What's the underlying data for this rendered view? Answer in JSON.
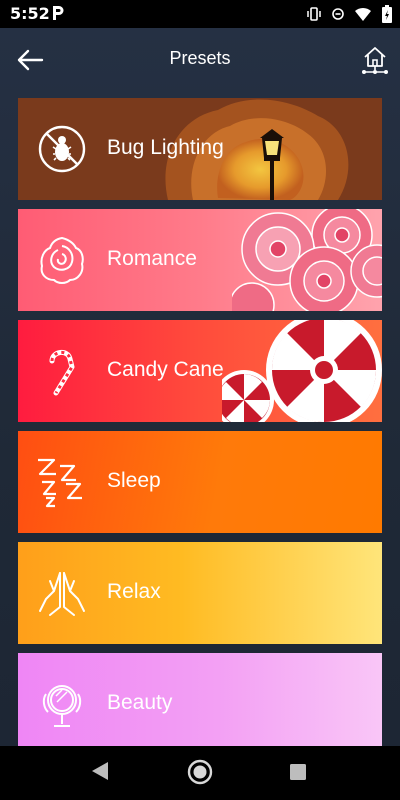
{
  "status_bar": {
    "time": "5:52",
    "icons": [
      "parking-app-icon",
      "vibrate-icon",
      "minus-icon",
      "wifi-icon",
      "battery-charging-icon"
    ]
  },
  "header": {
    "title": "Presets",
    "back_icon": "arrow-left-icon",
    "home_icon": "home-network-icon"
  },
  "presets": [
    {
      "label": "Bug Lighting",
      "icon": "no-bug-icon",
      "art": "street-lamp-glow"
    },
    {
      "label": "Romance",
      "icon": "rose-icon",
      "art": "pink-roses"
    },
    {
      "label": "Candy Cane",
      "icon": "candy-cane-icon",
      "art": "peppermint-candies"
    },
    {
      "label": "Sleep",
      "icon": "zzz-icon",
      "art": ""
    },
    {
      "label": "Relax",
      "icon": "praying-hands-icon",
      "art": ""
    },
    {
      "label": "Beauty",
      "icon": "vanity-mirror-icon",
      "art": ""
    }
  ],
  "nav_bar": {
    "back": "nav-back-triangle-icon",
    "home": "nav-home-circle-icon",
    "recents": "nav-recents-square-icon"
  },
  "colors": {
    "background": "#222c3c",
    "bug_lighting": "#7a3a1c",
    "romance": "#ff6b80",
    "candy_cane": "#ff2a40",
    "sleep": "#ff6a0c",
    "relax": "#ffb81f",
    "beauty": "#f29df4"
  }
}
